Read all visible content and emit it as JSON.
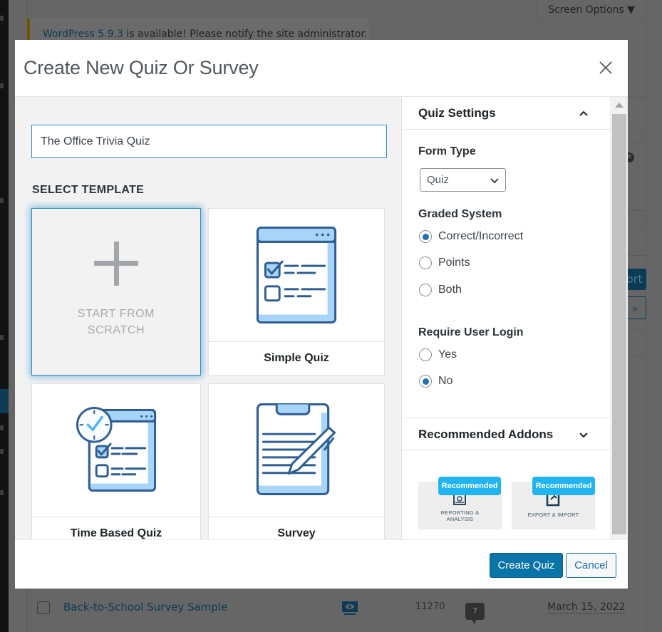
{
  "background": {
    "screen_options_label": "Screen Options ▼",
    "notice": {
      "link_text": "WordPress 5.9.3",
      "text": " is available! Please notify the site administrator."
    },
    "export_button_partial": "ort",
    "next_page_glyph": "»",
    "list_row": {
      "title": "Back-to-School Survey Sample",
      "id": "11270",
      "comment_count": "7",
      "date": "March 15, 2022"
    }
  },
  "modal": {
    "title": "Create New Quiz Or Survey",
    "close_icon": "close-icon",
    "quiz_name": {
      "value": "The Office Trivia Quiz",
      "placeholder": ""
    },
    "select_template_label": "SELECT TEMPLATE",
    "templates": [
      {
        "id": "scratch",
        "label_line1": "START FROM",
        "label_line2": "SCRATCH",
        "icon": "plus-icon",
        "selected": true
      },
      {
        "id": "simple-quiz",
        "label": "Simple Quiz",
        "icon": "checklist-window-icon",
        "selected": false
      },
      {
        "id": "time-based-quiz",
        "label": "Time Based Quiz",
        "icon": "timer-checklist-icon",
        "selected": false
      },
      {
        "id": "survey",
        "label": "Survey",
        "icon": "clipboard-pen-icon",
        "selected": false
      }
    ],
    "settings": {
      "header": "Quiz Settings",
      "expanded": true,
      "form_type": {
        "label": "Form Type",
        "selected": "Quiz"
      },
      "graded_system": {
        "label": "Graded System",
        "options": [
          {
            "label": "Correct/Incorrect",
            "checked": true
          },
          {
            "label": "Points",
            "checked": false
          },
          {
            "label": "Both",
            "checked": false
          }
        ]
      },
      "require_login": {
        "label": "Require User Login",
        "options": [
          {
            "label": "Yes",
            "checked": false
          },
          {
            "label": "No",
            "checked": true
          }
        ]
      }
    },
    "addons": {
      "header": "Recommended Addons",
      "expanded": false,
      "items": [
        {
          "badge": "Recommended",
          "label_line1": "REPORTING &",
          "label_line2": "ANALYSIS",
          "icon": "report-icon"
        },
        {
          "badge": "Recommended",
          "label_line1": "EXPORT & IMPORT",
          "label_line2": "",
          "icon": "export-icon"
        }
      ]
    },
    "footer": {
      "create_label": "Create Quiz",
      "cancel_label": "Cancel"
    }
  },
  "colors": {
    "primary": "#0a73a8",
    "focus_blue": "#2c8ec9",
    "badge_blue": "#22b4f0",
    "icon_blue": "#2e5e93",
    "icon_fill": "#a8d4f7",
    "overlay": "#666666"
  }
}
